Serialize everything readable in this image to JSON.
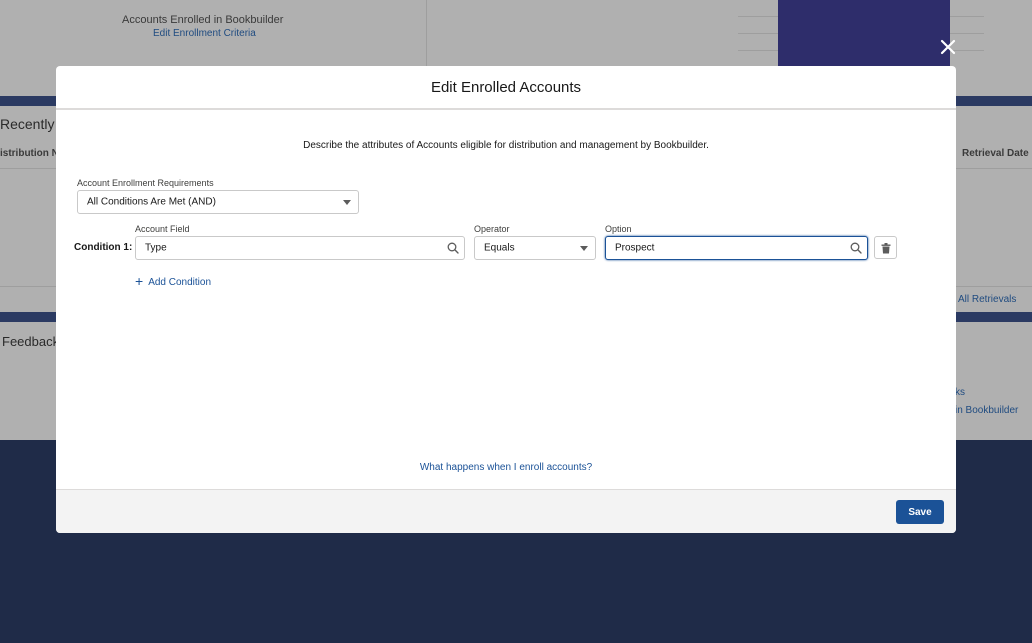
{
  "background": {
    "stat_label": "Accounts Enrolled in Bookbuilder",
    "stat_link": "Edit Enrollment Criteria",
    "recent_title": "Recently C",
    "col_distribution": "istribution N",
    "col_retrieval_date": "Retrieval Date",
    "all_retrievals_link": "All Retrievals",
    "feedback_title": "Feedback",
    "link_ks": "ks",
    "link_in_bookbuilder": "in Bookbuilder"
  },
  "modal": {
    "title": "Edit Enrolled Accounts",
    "description": "Describe the attributes of Accounts eligible for distribution and management by Bookbuilder.",
    "requirements": {
      "label": "Account Enrollment Requirements",
      "value": "All Conditions Are Met (AND)"
    },
    "condition": {
      "label": "Condition 1:",
      "field_label": "Account Field",
      "field_value": "Type",
      "operator_label": "Operator",
      "operator_value": "Equals",
      "option_label": "Option",
      "option_value": "Prospect"
    },
    "add_condition": "Add Condition",
    "help_link": "What happens when I enroll accounts?",
    "save_label": "Save"
  },
  "colors": {
    "primary": "#1b5297",
    "overlay": "#1f2b48"
  },
  "icons": {
    "close": "close-icon",
    "search": "search-icon",
    "trash": "trash-icon",
    "plus": "plus-icon",
    "dropdown": "chevron-down-icon"
  }
}
